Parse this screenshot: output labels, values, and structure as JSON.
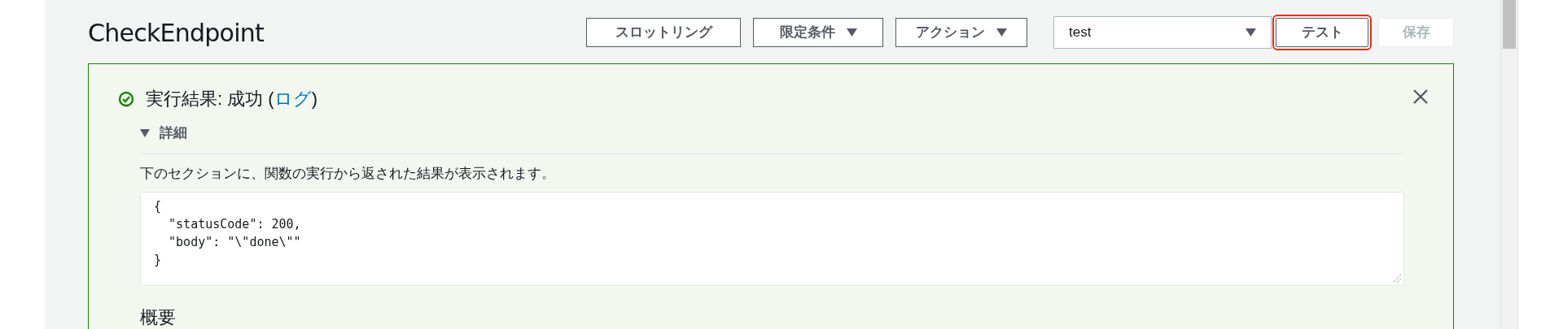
{
  "title": "CheckEndpoint",
  "toolbar": {
    "buttons": [
      {
        "label": "スロットリング",
        "dropdown": false,
        "disabled": false
      },
      {
        "label": "限定条件",
        "dropdown": true,
        "disabled": false
      },
      {
        "label": "アクション",
        "dropdown": true,
        "disabled": false
      }
    ],
    "test_event_select": {
      "value": "test"
    },
    "action_buttons": [
      {
        "label": "テスト",
        "disabled": false,
        "focused": true
      },
      {
        "label": "保存",
        "disabled": true,
        "focused": false
      }
    ]
  },
  "result": {
    "succeeded": true,
    "heading": "実行結果: 成功 (",
    "link": "ログ",
    "heading_end": ")",
    "details": {
      "label": "詳細",
      "expanded": true,
      "description": "下のセクションに、関数の実行から返された結果が表示されます。",
      "output": "{\n  \"statusCode\": 200,\n  \"body\": \"\\\"done\\\"\"\n}"
    },
    "summary_heading": "概要"
  }
}
